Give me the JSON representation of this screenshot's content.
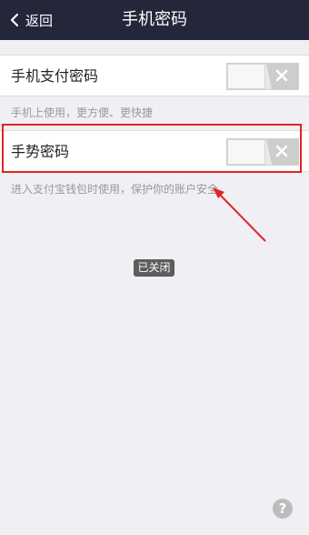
{
  "header": {
    "back_label": "返回",
    "title": "手机密码"
  },
  "settings": [
    {
      "label": "手机支付密码",
      "toggle": "off",
      "note": "手机上使用，更方便、更快捷"
    },
    {
      "label": "手势密码",
      "toggle": "off",
      "note": "进入支付宝钱包时使用，保护你的账户安全"
    }
  ],
  "toast": "已关闭",
  "help_icon": "?",
  "colors": {
    "header_bg": "#24263a",
    "page_bg": "#efeff4",
    "annotation": "#e32323"
  }
}
